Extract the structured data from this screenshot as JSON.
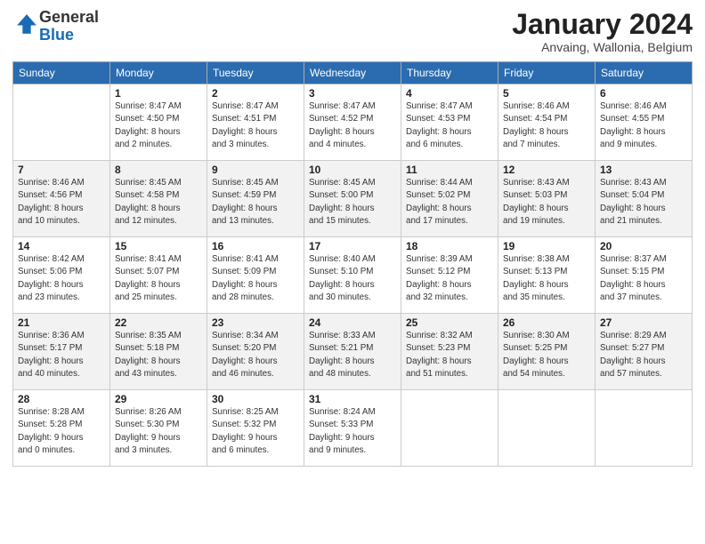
{
  "header": {
    "logo_line1": "General",
    "logo_line2": "Blue",
    "month": "January 2024",
    "location": "Anvaing, Wallonia, Belgium"
  },
  "weekdays": [
    "Sunday",
    "Monday",
    "Tuesday",
    "Wednesday",
    "Thursday",
    "Friday",
    "Saturday"
  ],
  "weeks": [
    [
      {
        "day": "",
        "info": ""
      },
      {
        "day": "1",
        "info": "Sunrise: 8:47 AM\nSunset: 4:50 PM\nDaylight: 8 hours\nand 2 minutes."
      },
      {
        "day": "2",
        "info": "Sunrise: 8:47 AM\nSunset: 4:51 PM\nDaylight: 8 hours\nand 3 minutes."
      },
      {
        "day": "3",
        "info": "Sunrise: 8:47 AM\nSunset: 4:52 PM\nDaylight: 8 hours\nand 4 minutes."
      },
      {
        "day": "4",
        "info": "Sunrise: 8:47 AM\nSunset: 4:53 PM\nDaylight: 8 hours\nand 6 minutes."
      },
      {
        "day": "5",
        "info": "Sunrise: 8:46 AM\nSunset: 4:54 PM\nDaylight: 8 hours\nand 7 minutes."
      },
      {
        "day": "6",
        "info": "Sunrise: 8:46 AM\nSunset: 4:55 PM\nDaylight: 8 hours\nand 9 minutes."
      }
    ],
    [
      {
        "day": "7",
        "info": "Sunrise: 8:46 AM\nSunset: 4:56 PM\nDaylight: 8 hours\nand 10 minutes."
      },
      {
        "day": "8",
        "info": "Sunrise: 8:45 AM\nSunset: 4:58 PM\nDaylight: 8 hours\nand 12 minutes."
      },
      {
        "day": "9",
        "info": "Sunrise: 8:45 AM\nSunset: 4:59 PM\nDaylight: 8 hours\nand 13 minutes."
      },
      {
        "day": "10",
        "info": "Sunrise: 8:45 AM\nSunset: 5:00 PM\nDaylight: 8 hours\nand 15 minutes."
      },
      {
        "day": "11",
        "info": "Sunrise: 8:44 AM\nSunset: 5:02 PM\nDaylight: 8 hours\nand 17 minutes."
      },
      {
        "day": "12",
        "info": "Sunrise: 8:43 AM\nSunset: 5:03 PM\nDaylight: 8 hours\nand 19 minutes."
      },
      {
        "day": "13",
        "info": "Sunrise: 8:43 AM\nSunset: 5:04 PM\nDaylight: 8 hours\nand 21 minutes."
      }
    ],
    [
      {
        "day": "14",
        "info": "Sunrise: 8:42 AM\nSunset: 5:06 PM\nDaylight: 8 hours\nand 23 minutes."
      },
      {
        "day": "15",
        "info": "Sunrise: 8:41 AM\nSunset: 5:07 PM\nDaylight: 8 hours\nand 25 minutes."
      },
      {
        "day": "16",
        "info": "Sunrise: 8:41 AM\nSunset: 5:09 PM\nDaylight: 8 hours\nand 28 minutes."
      },
      {
        "day": "17",
        "info": "Sunrise: 8:40 AM\nSunset: 5:10 PM\nDaylight: 8 hours\nand 30 minutes."
      },
      {
        "day": "18",
        "info": "Sunrise: 8:39 AM\nSunset: 5:12 PM\nDaylight: 8 hours\nand 32 minutes."
      },
      {
        "day": "19",
        "info": "Sunrise: 8:38 AM\nSunset: 5:13 PM\nDaylight: 8 hours\nand 35 minutes."
      },
      {
        "day": "20",
        "info": "Sunrise: 8:37 AM\nSunset: 5:15 PM\nDaylight: 8 hours\nand 37 minutes."
      }
    ],
    [
      {
        "day": "21",
        "info": "Sunrise: 8:36 AM\nSunset: 5:17 PM\nDaylight: 8 hours\nand 40 minutes."
      },
      {
        "day": "22",
        "info": "Sunrise: 8:35 AM\nSunset: 5:18 PM\nDaylight: 8 hours\nand 43 minutes."
      },
      {
        "day": "23",
        "info": "Sunrise: 8:34 AM\nSunset: 5:20 PM\nDaylight: 8 hours\nand 46 minutes."
      },
      {
        "day": "24",
        "info": "Sunrise: 8:33 AM\nSunset: 5:21 PM\nDaylight: 8 hours\nand 48 minutes."
      },
      {
        "day": "25",
        "info": "Sunrise: 8:32 AM\nSunset: 5:23 PM\nDaylight: 8 hours\nand 51 minutes."
      },
      {
        "day": "26",
        "info": "Sunrise: 8:30 AM\nSunset: 5:25 PM\nDaylight: 8 hours\nand 54 minutes."
      },
      {
        "day": "27",
        "info": "Sunrise: 8:29 AM\nSunset: 5:27 PM\nDaylight: 8 hours\nand 57 minutes."
      }
    ],
    [
      {
        "day": "28",
        "info": "Sunrise: 8:28 AM\nSunset: 5:28 PM\nDaylight: 9 hours\nand 0 minutes."
      },
      {
        "day": "29",
        "info": "Sunrise: 8:26 AM\nSunset: 5:30 PM\nDaylight: 9 hours\nand 3 minutes."
      },
      {
        "day": "30",
        "info": "Sunrise: 8:25 AM\nSunset: 5:32 PM\nDaylight: 9 hours\nand 6 minutes."
      },
      {
        "day": "31",
        "info": "Sunrise: 8:24 AM\nSunset: 5:33 PM\nDaylight: 9 hours\nand 9 minutes."
      },
      {
        "day": "",
        "info": ""
      },
      {
        "day": "",
        "info": ""
      },
      {
        "day": "",
        "info": ""
      }
    ]
  ]
}
